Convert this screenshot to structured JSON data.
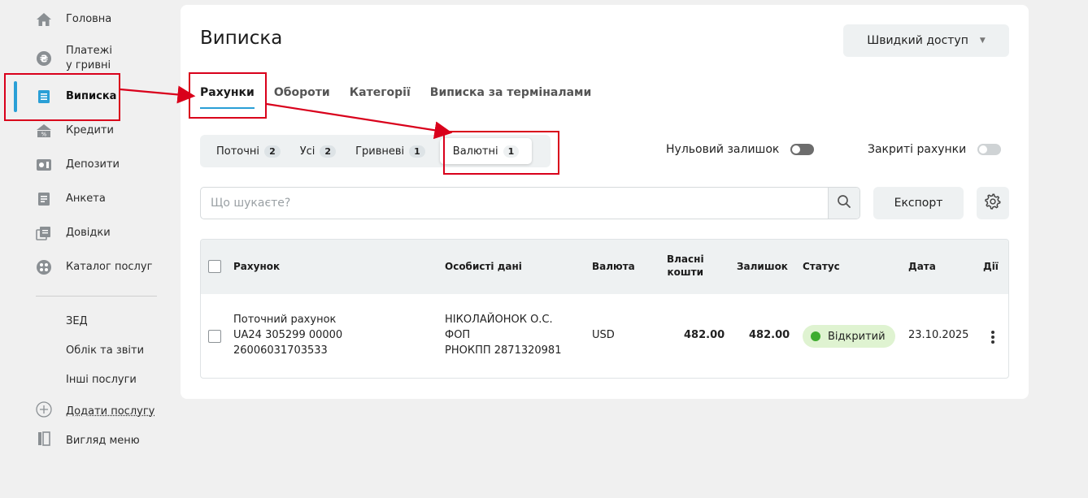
{
  "sidebar": {
    "items": [
      {
        "label": "Головна",
        "icon": "home-icon"
      },
      {
        "label": "Платежі\nу гривні",
        "label_line1": "Платежі",
        "label_line2": "у гривні",
        "icon": "hryvnia-icon"
      },
      {
        "label": "Виписка",
        "icon": "statement-icon"
      },
      {
        "label": "Кредити",
        "icon": "credit-icon"
      },
      {
        "label": "Депозити",
        "icon": "deposit-icon"
      },
      {
        "label": "Анкета",
        "icon": "form-icon"
      },
      {
        "label": "Довідки",
        "icon": "documents-icon"
      },
      {
        "label": "Каталог послуг",
        "icon": "catalog-icon"
      }
    ],
    "sub_items": [
      "ЗЕД",
      "Облік та звіти",
      "Інші послуги"
    ],
    "add_service": "Додати послугу",
    "view_menu": "Вигляд меню",
    "accent_color": "#2a9fd6"
  },
  "header": {
    "title": "Виписка",
    "quick_access": "Швидкий доступ"
  },
  "tabs": [
    "Рахунки",
    "Обороти",
    "Категорії",
    "Виписка за терміналами"
  ],
  "filters": [
    {
      "label": "Поточні",
      "count": "2"
    },
    {
      "label": "Усі",
      "count": "2"
    },
    {
      "label": "Гривневі",
      "count": "1"
    },
    {
      "label": "Валютні",
      "count": "1"
    }
  ],
  "toggles": {
    "zero_balance": "Нульовий залишок",
    "closed_accounts": "Закриті рахунки"
  },
  "search": {
    "placeholder": "Що шукаєте?"
  },
  "export_label": "Експорт",
  "table": {
    "headers": {
      "account": "Рахунок",
      "personal": "Особисті дані",
      "currency": "Валюта",
      "own_funds_1": "Власні",
      "own_funds_2": "кошти",
      "balance": "Залишок",
      "status": "Статус",
      "date": "Дата",
      "actions": "Дії"
    },
    "rows": [
      {
        "account_line1": "Поточний рахунок",
        "account_line2": "UA24 305299 00000",
        "account_line3": "26006031703533",
        "personal_line1": "НІКОЛАЙОНОК О.С.",
        "personal_line2": "ФОП",
        "personal_line3": "РНОКПП 2871320981",
        "currency": "USD",
        "own_funds": "482.00",
        "balance": "482.00",
        "status": "Відкритий",
        "date": "23.10.2025"
      }
    ]
  },
  "colors": {
    "status_open": "#3eac2f",
    "status_badge_bg": "#dff3d1",
    "annotation": "#d9001b"
  }
}
